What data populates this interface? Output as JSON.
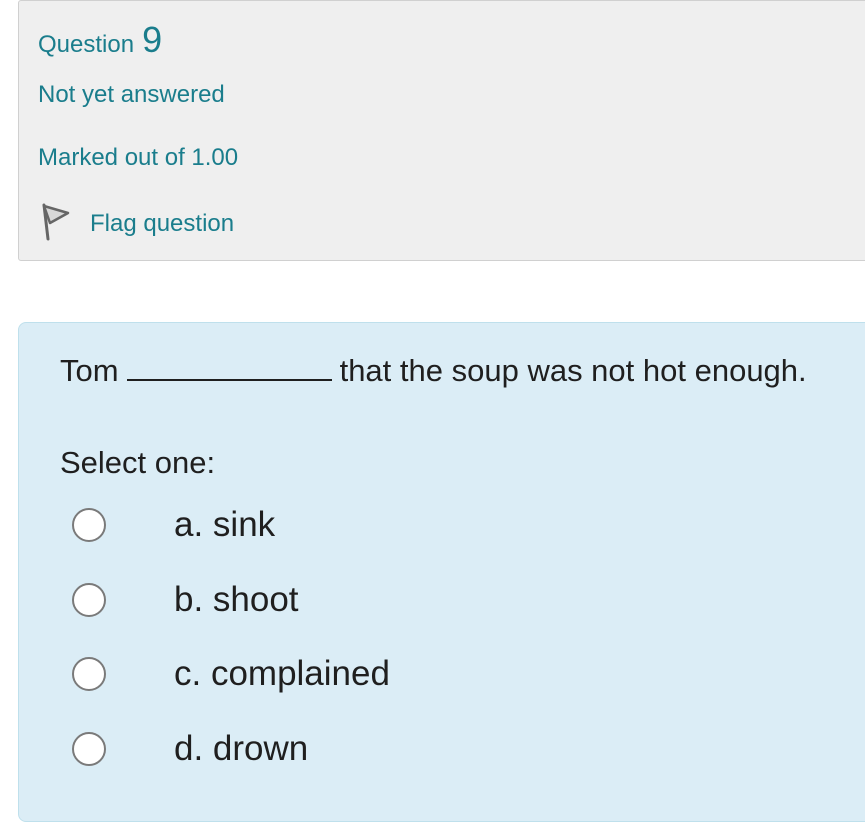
{
  "info": {
    "question_word": "Question",
    "question_number": "9",
    "state": "Not yet answered",
    "grade": "Marked out of 1.00",
    "flag_label": "Flag question"
  },
  "question": {
    "text_before": "Tom",
    "text_after": "that the soup was not hot enough.",
    "prompt": "Select one:",
    "options": [
      {
        "label": "a. sink"
      },
      {
        "label": "b. shoot"
      },
      {
        "label": "c. complained"
      },
      {
        "label": "d. drown"
      }
    ]
  },
  "colors": {
    "link_teal": "#1a7d8c",
    "info_bg": "#efefef",
    "content_bg": "#dbedf6"
  }
}
